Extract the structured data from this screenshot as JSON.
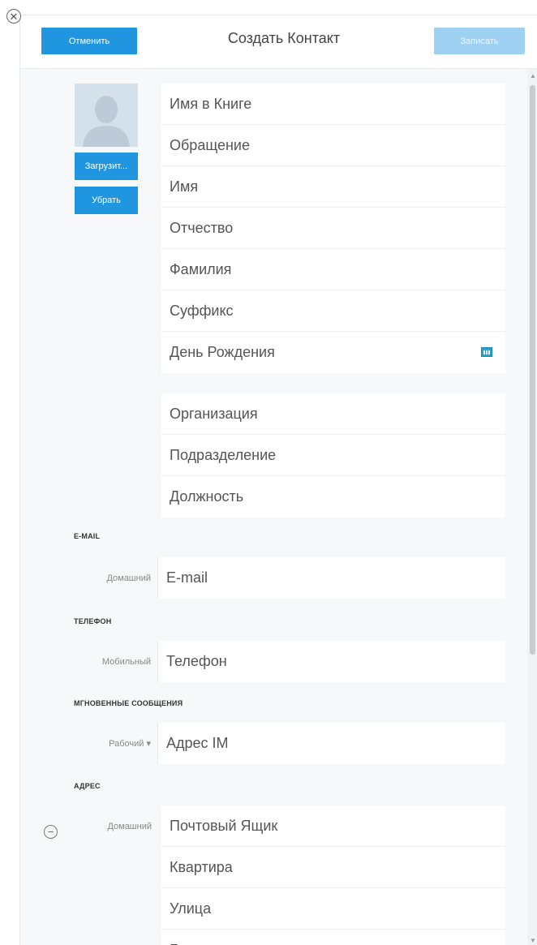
{
  "header": {
    "cancel_label": "Отменить",
    "title": "Создать Контакт",
    "save_label": "Записать"
  },
  "photo": {
    "upload_label": "Загрузит...",
    "remove_label": "Убрать"
  },
  "name_fields": [
    "Имя в Книге",
    "Обращение",
    "Имя",
    "Отчество",
    "Фамилия",
    "Суффикс",
    "День Рождения"
  ],
  "org_fields": [
    "Организация",
    "Подразделение",
    "Должность"
  ],
  "email": {
    "section": "E-MAIL",
    "type": "Домашний",
    "placeholder": "E-mail"
  },
  "phone": {
    "section": "ТЕЛЕФОН",
    "type": "Мобильный",
    "placeholder": "Телефон"
  },
  "im": {
    "section": "МГНОВЕННЫЕ СООБЩЕНИЯ",
    "type": "Рабочий ▾",
    "placeholder": "Адрес IM"
  },
  "address": {
    "section": "АДРЕС",
    "type": "Домашний",
    "fields": [
      "Почтовый Ящик",
      "Квартира",
      "Улица",
      "Город"
    ]
  },
  "icons": {
    "close": "close-circle-icon",
    "calendar": "calendar-icon",
    "remove": "minus-circle-icon",
    "avatar": "person-silhouette-icon"
  },
  "colors": {
    "primary_button": "#2196e0",
    "disabled_button": "#9fd2f2",
    "calendar": "#2aa0cc"
  }
}
